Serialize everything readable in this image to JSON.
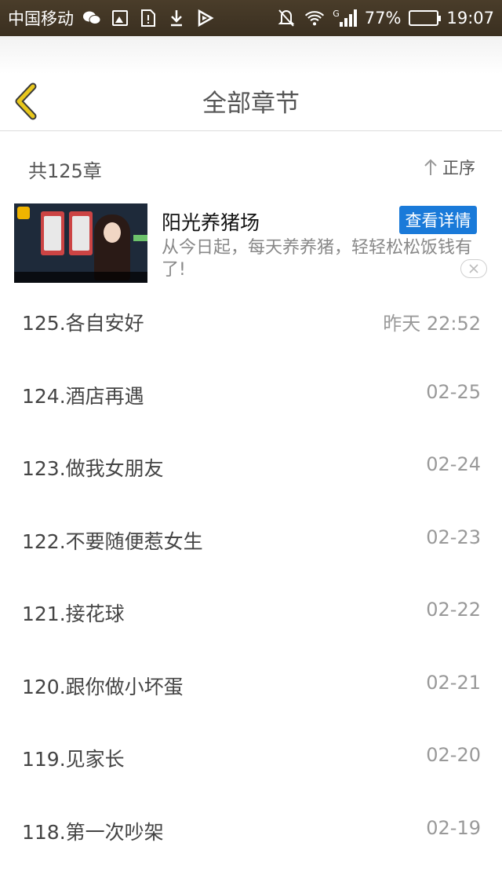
{
  "status_bar": {
    "carrier": "中国移动",
    "network": "G",
    "battery": "77%",
    "battery_level": 0.77,
    "time": "19:07"
  },
  "header": {
    "title": "全部章节"
  },
  "summary": {
    "count": "共125章",
    "sort": "正序"
  },
  "ad": {
    "title": "阳光养猪场",
    "description": "从今日起，每天养养猪，轻轻松松饭钱有了!",
    "cta": "查看详情"
  },
  "chapters": [
    {
      "title": "125.各自安好",
      "date": "昨天 22:52"
    },
    {
      "title": "124.酒店再遇",
      "date": "02-25"
    },
    {
      "title": "123.做我女朋友",
      "date": "02-24"
    },
    {
      "title": "122.不要随便惹女生",
      "date": "02-23"
    },
    {
      "title": "121.接花球",
      "date": "02-22"
    },
    {
      "title": "120.跟你做小坏蛋",
      "date": "02-21"
    },
    {
      "title": "119.见家长",
      "date": "02-20"
    },
    {
      "title": "118.第一次吵架",
      "date": "02-19"
    }
  ],
  "colors": {
    "status_bar_bg": "#3f3425",
    "back_arrow": "#e8c71c",
    "cta_bg": "#1a7ad9"
  }
}
